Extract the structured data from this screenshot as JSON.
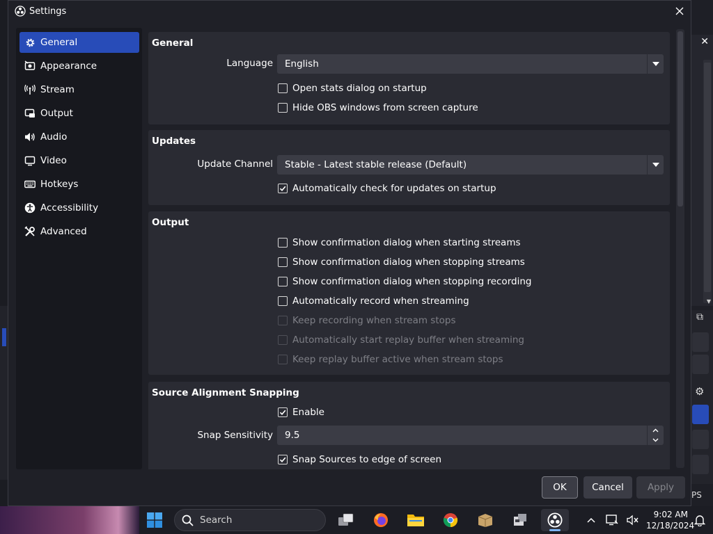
{
  "window": {
    "title": "Settings"
  },
  "sidebar": {
    "items": [
      {
        "label": "General",
        "icon": "gear-icon",
        "active": true
      },
      {
        "label": "Appearance",
        "icon": "appearance-icon"
      },
      {
        "label": "Stream",
        "icon": "antenna-icon"
      },
      {
        "label": "Output",
        "icon": "output-icon"
      },
      {
        "label": "Audio",
        "icon": "speaker-icon"
      },
      {
        "label": "Video",
        "icon": "monitor-icon"
      },
      {
        "label": "Hotkeys",
        "icon": "keyboard-icon"
      },
      {
        "label": "Accessibility",
        "icon": "accessibility-icon"
      },
      {
        "label": "Advanced",
        "icon": "tools-icon"
      }
    ]
  },
  "general": {
    "title": "General",
    "language_label": "Language",
    "language_value": "English",
    "open_stats": "Open stats dialog on startup",
    "hide_obs": "Hide OBS windows from screen capture"
  },
  "updates": {
    "title": "Updates",
    "channel_label": "Update Channel",
    "channel_value": "Stable - Latest stable release (Default)",
    "auto_check": "Automatically check for updates on startup"
  },
  "output": {
    "title": "Output",
    "items": [
      {
        "label": "Show confirmation dialog when starting streams",
        "checked": false,
        "enabled": true
      },
      {
        "label": "Show confirmation dialog when stopping streams",
        "checked": false,
        "enabled": true
      },
      {
        "label": "Show confirmation dialog when stopping recording",
        "checked": false,
        "enabled": true
      },
      {
        "label": "Automatically record when streaming",
        "checked": false,
        "enabled": true
      },
      {
        "label": "Keep recording when stream stops",
        "checked": false,
        "enabled": false
      },
      {
        "label": "Automatically start replay buffer when streaming",
        "checked": false,
        "enabled": false
      },
      {
        "label": "Keep replay buffer active when stream stops",
        "checked": false,
        "enabled": false
      }
    ]
  },
  "snapping": {
    "title": "Source Alignment Snapping",
    "enable": "Enable",
    "sensitivity_label": "Snap Sensitivity",
    "sensitivity_value": "9.5",
    "snap_edge": "Snap Sources to edge of screen"
  },
  "buttons": {
    "ok": "OK",
    "cancel": "Cancel",
    "apply": "Apply"
  },
  "taskbar": {
    "search_placeholder": "Search",
    "time": "9:02 AM",
    "date": "12/18/2024"
  },
  "background": {
    "partial_text": "PS"
  },
  "colors": {
    "accent": "#284cb8",
    "window_bg": "#1f2027",
    "group_bg": "#2a2b33",
    "control_bg": "#3b3c45"
  }
}
